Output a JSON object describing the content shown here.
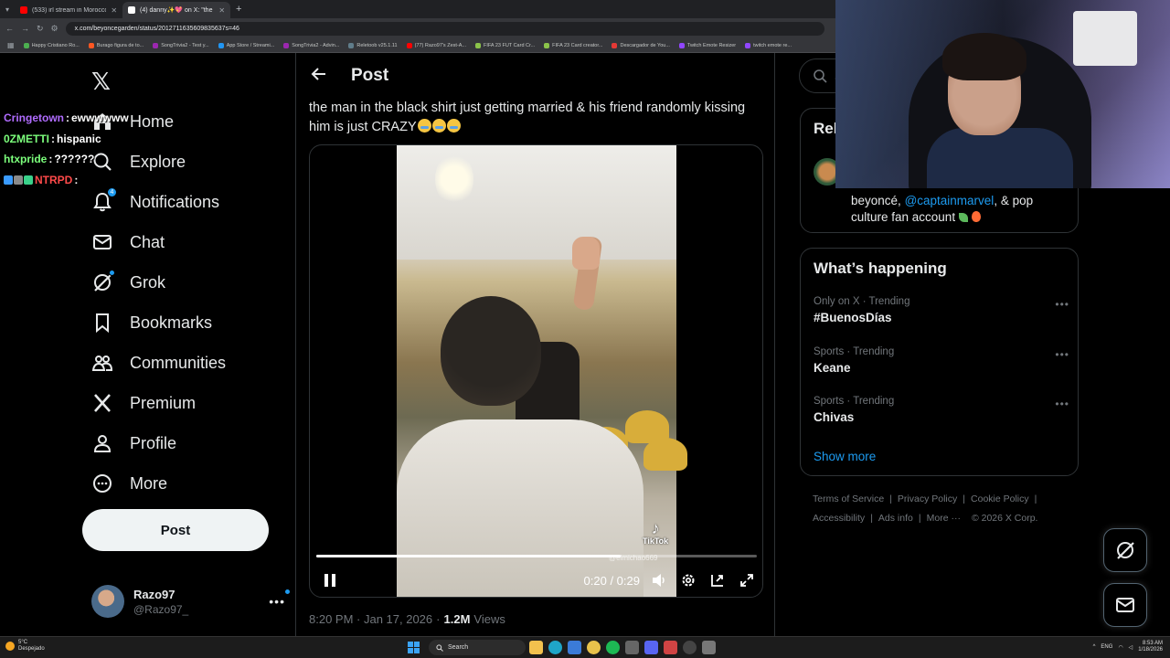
{
  "browser": {
    "tabs": [
      {
        "title": "(533) irl stream in Morocco so...",
        "active": false,
        "favicon_color": "#ff0000"
      },
      {
        "title": "(4) danny✨💖 on X: \"the m...",
        "active": true,
        "favicon_color": "#ffffff"
      }
    ],
    "url": "x.com/beyoncegarden/status/2012711635609835637s=46",
    "bookmarks": [
      {
        "label": "Happy Cristiano Ro...",
        "color": "#4caf50"
      },
      {
        "label": "Burago figura de to...",
        "color": "#ff5722"
      },
      {
        "label": "SongTrivia2 - Test y...",
        "color": "#9c27b0"
      },
      {
        "label": "App Store / Streami...",
        "color": "#2196f3"
      },
      {
        "label": "SongTrivia2 - Advin...",
        "color": "#9c27b0"
      },
      {
        "label": "Reletoob v25.1.11",
        "color": "#607d8b"
      },
      {
        "label": "(77) Razo97's Zest-A...",
        "color": "#ff0000"
      },
      {
        "label": "FIFA 23 FUT Card Cr...",
        "color": "#8bc34a"
      },
      {
        "label": "FIFA 23 Card creator...",
        "color": "#8bc34a"
      },
      {
        "label": "Descargador de You...",
        "color": "#e53935"
      },
      {
        "label": "Twitch Emote Resizer",
        "color": "#9146ff"
      },
      {
        "label": "twitch emote re...",
        "color": "#9146ff"
      }
    ]
  },
  "chat": [
    {
      "user": "Cringetown",
      "color": "#b06cff",
      "msg": "ewwwwww"
    },
    {
      "user": "0ZMETTI",
      "color": "#7cff7c",
      "msg": "hispanic"
    },
    {
      "user": "htxpride",
      "color": "#7cff7c",
      "msg": "??????"
    },
    {
      "user": "NTRPD",
      "color": "#ff4a4a",
      "msg": "",
      "emotes": [
        "#3a9bff",
        "#8a8a8a",
        "#3ad18a"
      ]
    }
  ],
  "nav": {
    "items": [
      {
        "label": "Home",
        "icon": "home-icon"
      },
      {
        "label": "Explore",
        "icon": "search-icon"
      },
      {
        "label": "Notifications",
        "icon": "bell-icon",
        "badge": "4"
      },
      {
        "label": "Chat",
        "icon": "mail-icon"
      },
      {
        "label": "Grok",
        "icon": "grok-icon"
      },
      {
        "label": "Bookmarks",
        "icon": "bookmark-icon"
      },
      {
        "label": "Communities",
        "icon": "communities-icon"
      },
      {
        "label": "Premium",
        "icon": "x-logo-icon"
      },
      {
        "label": "Profile",
        "icon": "person-icon"
      },
      {
        "label": "More",
        "icon": "more-circle-icon"
      }
    ],
    "post_label": "Post"
  },
  "account": {
    "name": "Razo97",
    "handle": "@Razo97_"
  },
  "post": {
    "header_title": "Post",
    "text": "the man in the black shirt just getting married & his friend randomly kissing him is just CRAZY",
    "video": {
      "current_time": "0:20",
      "duration": "0:29",
      "time_label": "0:20 / 0:29",
      "progress_fraction": 0.69,
      "watermark": "TikTok",
      "watermark_handle": "@elmichao669"
    },
    "timestamp": "8:20 PM · Jan 17, 2026",
    "views_count": "1.2M",
    "views_label": "Views"
  },
  "right": {
    "search_placeholder": "Se",
    "relevant_title": "Rel",
    "relevant_bio_prefix": "beyoncé,",
    "relevant_bio_mention": "@captainmarvel",
    "relevant_bio_suffix": ", & pop culture fan account",
    "trending_title": "What’s happening",
    "trends": [
      {
        "meta": "Only on X · Trending",
        "name": "#BuenosDías"
      },
      {
        "meta": "Sports · Trending",
        "name": "Keane"
      },
      {
        "meta": "Sports · Trending",
        "name": "Chivas"
      }
    ],
    "show_more": "Show more",
    "footer": {
      "terms": "Terms of Service",
      "privacy": "Privacy Policy",
      "cookie": "Cookie Policy",
      "accessibility": "Accessibility",
      "ads": "Ads info",
      "more": "More ···",
      "copyright": "© 2026 X Corp."
    }
  },
  "taskbar": {
    "weather_temp": "5°C",
    "weather_desc": "Despejado",
    "search_label": "Search",
    "lang": "ENG",
    "time": "8:53 AM",
    "date": "1/18/2026"
  }
}
